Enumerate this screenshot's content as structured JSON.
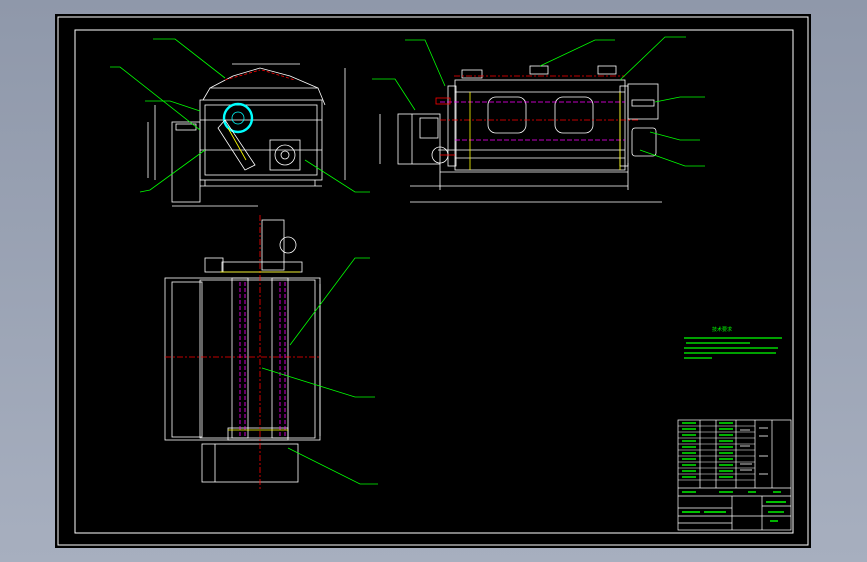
{
  "drawing": {
    "notes_title": "技术要求",
    "notes_lines": [
      "",
      "",
      "",
      "",
      ""
    ],
    "title_block_rows": 13,
    "dimension_labels": [],
    "colors": {
      "background": "#000000",
      "frame": "#ffffff",
      "outline": "#ffffff",
      "leader": "#00ff00",
      "centerline": "#ff0000",
      "hidden": "#ff00ff",
      "accent": "#00ffff",
      "secondary": "#ffff00"
    }
  }
}
